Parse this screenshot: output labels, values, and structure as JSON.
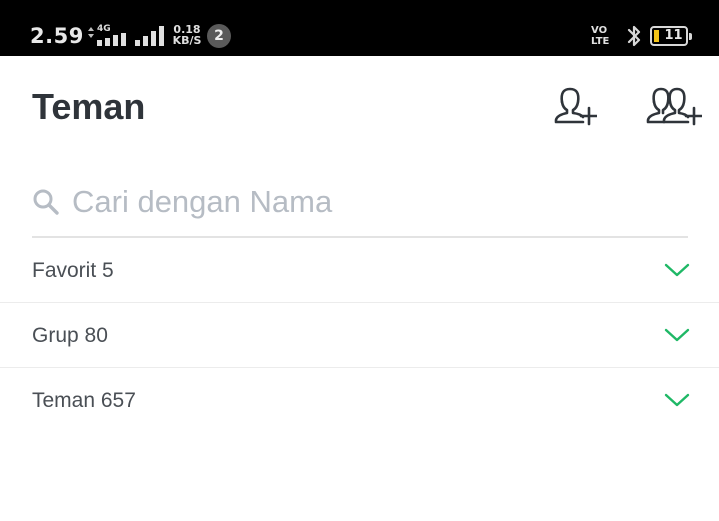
{
  "status_bar": {
    "time": "2.59",
    "network_type": "4G",
    "speed_value": "0.18",
    "speed_unit": "KB/S",
    "notification_count": "2",
    "volte_top": "VO",
    "volte_bottom": "LTE",
    "battery_level": "11",
    "battery_fill_percent": 11,
    "battery_color": "#f3c418"
  },
  "header": {
    "title": "Teman",
    "add_friend_icon": "add-friend-icon",
    "add_group_icon": "add-group-icon"
  },
  "search": {
    "placeholder": "Cari dengan Nama",
    "value": ""
  },
  "sections": [
    {
      "label": "Favorit 5"
    },
    {
      "label": "Grup 80"
    },
    {
      "label": "Teman 657"
    }
  ],
  "colors": {
    "accent_chevron": "#1fb866",
    "title_text": "#2f343a",
    "placeholder_text": "#b6bcc4"
  }
}
